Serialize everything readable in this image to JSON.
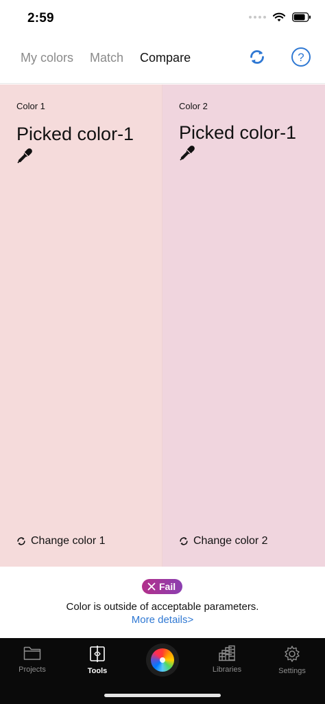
{
  "status": {
    "time": "2:59"
  },
  "nav": {
    "tabs": [
      {
        "label": "My colors"
      },
      {
        "label": "Match"
      },
      {
        "label": "Compare"
      }
    ],
    "active_tab": "Compare",
    "icons": [
      "refresh-icon",
      "help-icon"
    ]
  },
  "compare": {
    "left": {
      "label": "Color 1",
      "name": "Picked color-1",
      "change_label": "Change color 1",
      "swatch": "#f5dbdb"
    },
    "right": {
      "label": "Color 2",
      "name": "Picked color-1",
      "change_label": "Change color 2",
      "swatch": "#f0d5de"
    }
  },
  "result": {
    "badge": "Fail",
    "message": "Color is outside of acceptable parameters.",
    "link": "More details>"
  },
  "tabbar": {
    "items": [
      {
        "label": "Projects",
        "icon": "folder-icon"
      },
      {
        "label": "Tools",
        "icon": "tools-icon"
      },
      {
        "label": "Libraries",
        "icon": "libraries-icon"
      },
      {
        "label": "Settings",
        "icon": "gear-icon"
      }
    ],
    "active": "Tools",
    "center_icon": "color-wheel-icon"
  },
  "colors": {
    "accent": "#2f78d3",
    "fail_gradient_start": "#b2308a",
    "fail_gradient_end": "#8b3fb1",
    "tabbar_bg": "#0a0a0a"
  }
}
